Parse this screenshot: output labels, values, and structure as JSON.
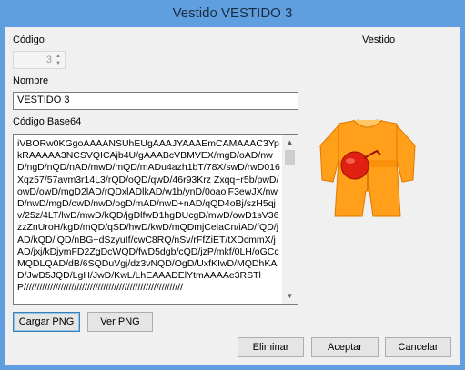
{
  "window": {
    "title": "Vestido VESTIDO 3"
  },
  "form": {
    "codigo_label": "Código",
    "codigo_value": "3",
    "vestido_label": "Vestido",
    "nombre_label": "Nombre",
    "nombre_value": "VESTIDO 3",
    "base64_label": "Código Base64",
    "base64_value": "iVBORw0KGgoAAAANSUhEUgAAAJYAAAEmCAMAAAC3YpkRAAAAA3NCSVQICAjb4U/gAAABcVBMVEX/mgD/oAD/nwD/ngD/nQD/nAD/mwD/mQD/mADu4azh1bT/78X/swD/rwD016Xqz57/57avm3r14L3/rQD/oQD/qwD/46r93Krz Zxqq+r5b/pwD/owD/owD/mgD2lAD/rQDxlADlkAD/w1b/ynD/0oaoiF3ewJX/nwD/nwD/mgD/owD/nwD/ogD/mAD/nwD+nAD/qQD4oBj/szH5qjv/25z/4LT/lwD/mwD/kQD/jgDlfwD1hgDUcgD/mwD/owD1sV36zzZnUroH/kgD/mQD/qSD/hwD/kwD/mQDmjCeiaCn/iAD/fQD/jAD/kQD/iQD/nBG+dSzyuIf/cwC8RQ/nSv/rFfZiET/tXDcmmX/jAD/jxj/kDjymFD2ZgDcWQD/fwD5dgb/cQD/jzP/mkf/0LH/oGCcMQDLQAD/dB/6SQDuVgj/dz3vNQD/OgD/UxfKIwD/MQDhKAD/JwD5JQD/LgH/JwD/KwL/LhEAAADElYtmAAAAe3RSTlP////////////////////////////////////////////////////////////"
  },
  "buttons": {
    "cargar": "Cargar PNG",
    "ver": "Ver PNG",
    "eliminar": "Eliminar",
    "aceptar": "Aceptar",
    "cancelar": "Cancelar"
  },
  "icons": {
    "spin_up": "spin-up-arrow",
    "spin_down": "spin-down-arrow",
    "scroll_up": "scroll-up-arrow",
    "scroll_down": "scroll-down-arrow"
  },
  "colors": {
    "titlebar": "#5f9fe0",
    "dress_orange": "#ff9f1a",
    "ball_red": "#e02010"
  }
}
